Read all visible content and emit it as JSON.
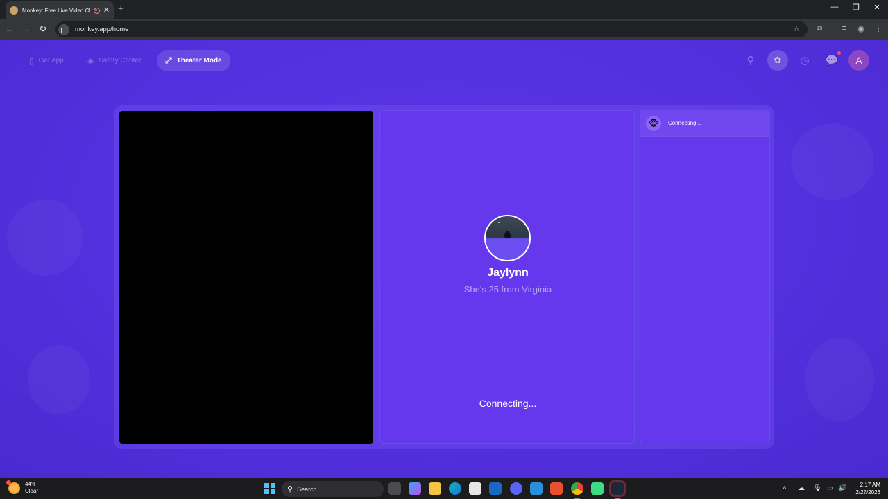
{
  "browser": {
    "tab_title": "Monkey: Free Live Video Ch",
    "tab_close": "✕",
    "new_tab": "+",
    "url": "monkey.app/home",
    "window_controls": {
      "minimize": "—",
      "restore": "❐",
      "close": "✕"
    }
  },
  "header": {
    "get_app": "Get App",
    "safety_center": "Safety Center",
    "theater_mode": "Theater Mode",
    "avatar_letter": "A"
  },
  "match": {
    "name": "Jaylynn",
    "description": "She's 25 from Virginia",
    "status": "Connecting..."
  },
  "chat": {
    "header_status": "Connecting..."
  },
  "taskbar": {
    "weather_temp": "44°F",
    "weather_condition": "Clear",
    "search_label": "Search",
    "time": "2:17 AM",
    "date": "2/27/2026"
  },
  "colors": {
    "page_bg": "#5430de",
    "stage_bg": "#6538ee",
    "video_bg": "#000000"
  }
}
